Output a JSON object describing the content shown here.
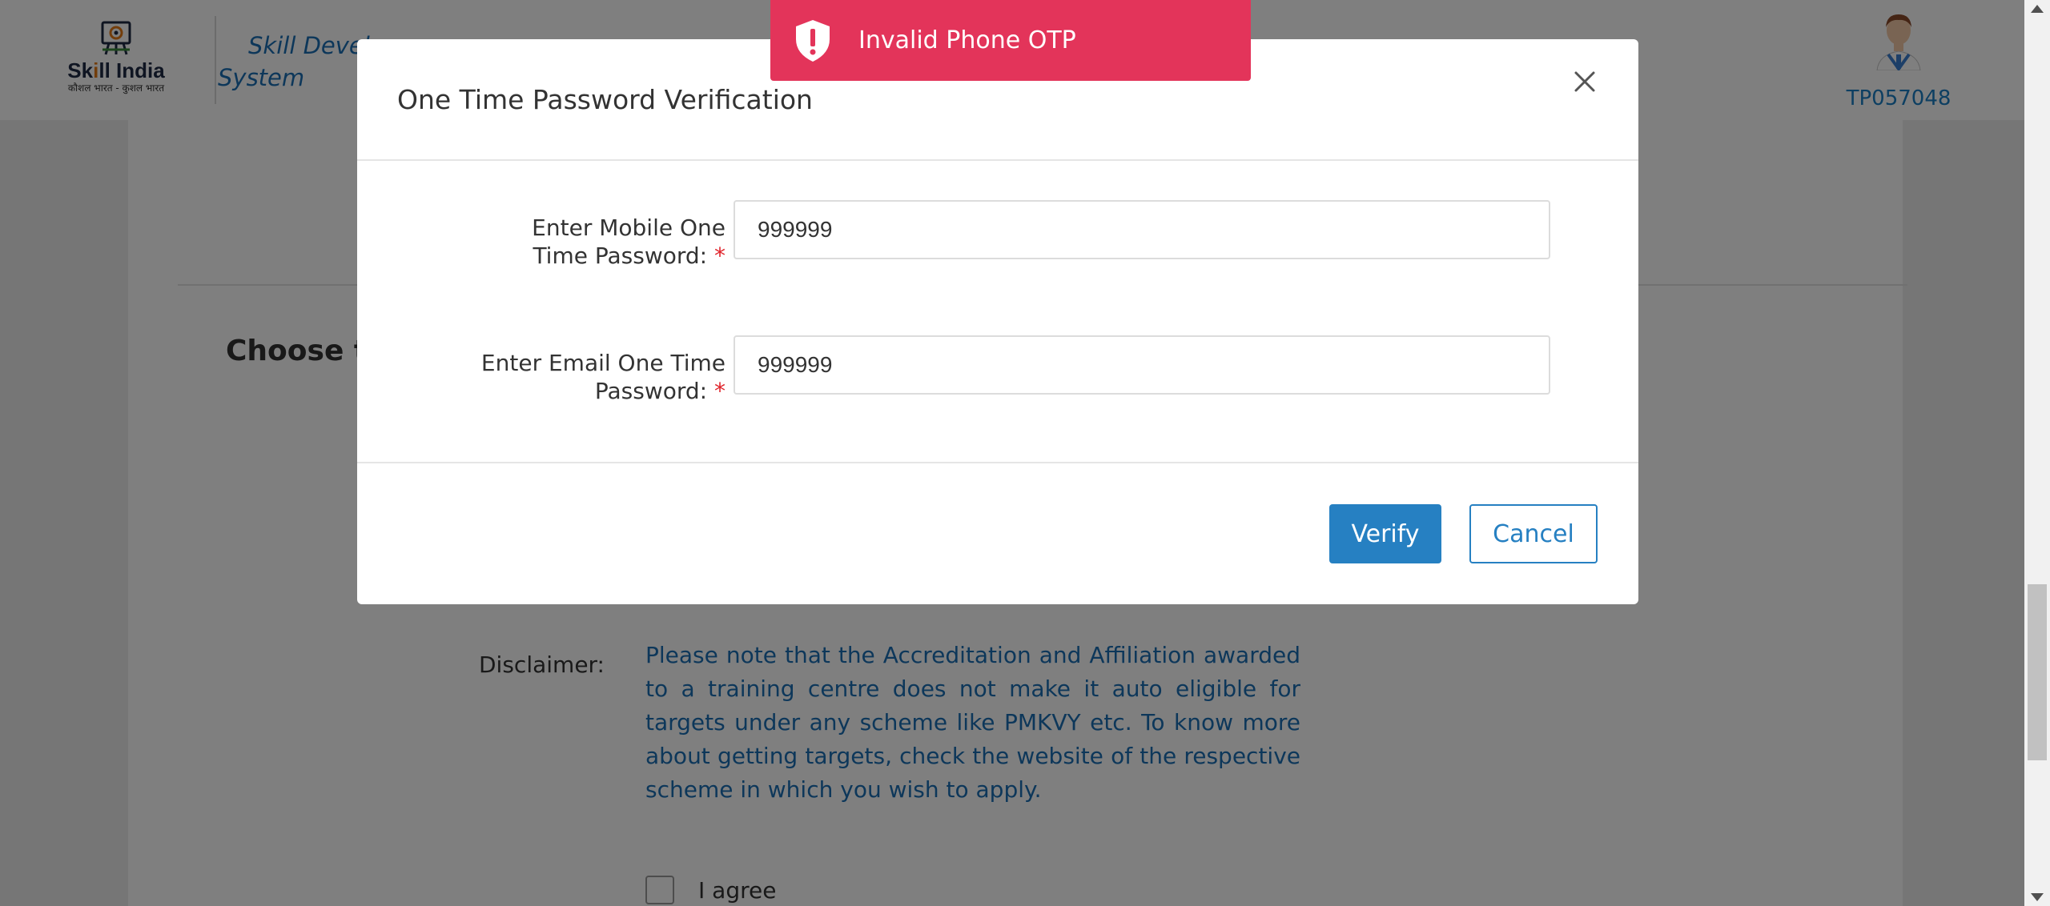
{
  "header": {
    "logo_title_prefix": "Sk",
    "logo_title_accent": "i",
    "logo_title_suffix": "ll India",
    "logo_subtitle": "कौशल भारत - कुशल भारत",
    "brand_line1": "Skill Devel",
    "brand_line2": "System",
    "user_id": "TP057048"
  },
  "page": {
    "choose_heading": "Choose th",
    "disclaimer_label": "Disclaimer:",
    "disclaimer_text": "Please note that the Accreditation and Affiliation awarded to a training centre does not make it auto eligible for targets under any scheme like PMKVY etc. To know more about getting targets, check the website of the respective scheme in which you wish to apply.",
    "agree_label": "I agree"
  },
  "modal": {
    "title": "One Time Password Verification",
    "mobile_label_line1": "Enter Mobile One",
    "mobile_label_line2": "Time Password:",
    "mobile_value": "999999",
    "email_label_line1": "Enter Email One Time",
    "email_label_line2": "Password:",
    "email_value": "999999",
    "required_mark": "*",
    "verify_label": "Verify",
    "cancel_label": "Cancel"
  },
  "toast": {
    "message": "Invalid Phone OTP",
    "icon": "shield-alert-icon",
    "color": "#e3345a"
  },
  "colors": {
    "primary": "#2680c2",
    "link_blue": "#1a6fb5",
    "required": "#e0242b"
  }
}
